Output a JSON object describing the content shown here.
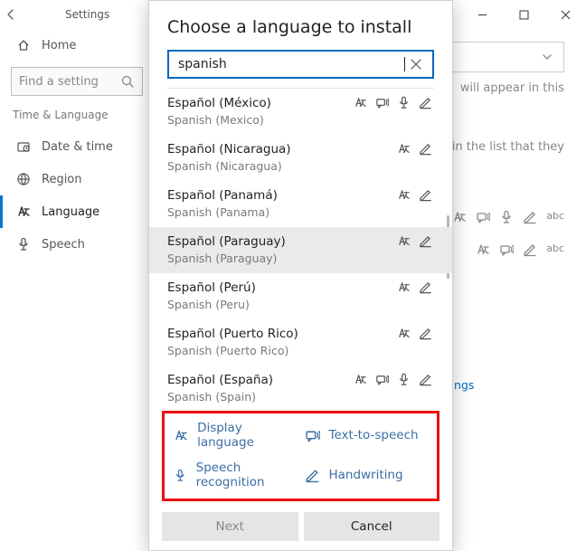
{
  "window": {
    "title": "Settings"
  },
  "sidebar": {
    "home": "Home",
    "search_placeholder": "Find a setting",
    "group": "Time & Language",
    "items": [
      "Date & time",
      "Region",
      "Language",
      "Speech"
    ],
    "selected_index": 2
  },
  "main": {
    "hint1": "will appear in this",
    "hint2": "ge in the list that they"
  },
  "modal": {
    "title": "Choose a language to install",
    "search_value": "spanish",
    "languages": [
      {
        "name": "Español (México)",
        "sub": "Spanish (Mexico)",
        "caps": [
          "display",
          "tts",
          "speech",
          "hand"
        ],
        "selected": false
      },
      {
        "name": "Español (Nicaragua)",
        "sub": "Spanish (Nicaragua)",
        "caps": [
          "display",
          "hand"
        ],
        "selected": false
      },
      {
        "name": "Español (Panamá)",
        "sub": "Spanish (Panama)",
        "caps": [
          "display",
          "hand"
        ],
        "selected": false
      },
      {
        "name": "Español (Paraguay)",
        "sub": "Spanish (Paraguay)",
        "caps": [
          "display",
          "hand"
        ],
        "selected": true
      },
      {
        "name": "Español (Perú)",
        "sub": "Spanish (Peru)",
        "caps": [
          "display",
          "hand"
        ],
        "selected": false
      },
      {
        "name": "Español (Puerto Rico)",
        "sub": "Spanish (Puerto Rico)",
        "caps": [
          "display",
          "hand"
        ],
        "selected": false
      },
      {
        "name": "Español (España)",
        "sub": "Spanish (Spain)",
        "caps": [
          "display",
          "tts",
          "speech",
          "hand"
        ],
        "selected": false
      }
    ],
    "legend": {
      "display": "Display language",
      "tts": "Text-to-speech",
      "speech": "Speech recognition",
      "hand": "Handwriting"
    },
    "buttons": {
      "next": "Next",
      "cancel": "Cancel"
    }
  },
  "footer_link": "Spelling, typing, & keyboard settings"
}
